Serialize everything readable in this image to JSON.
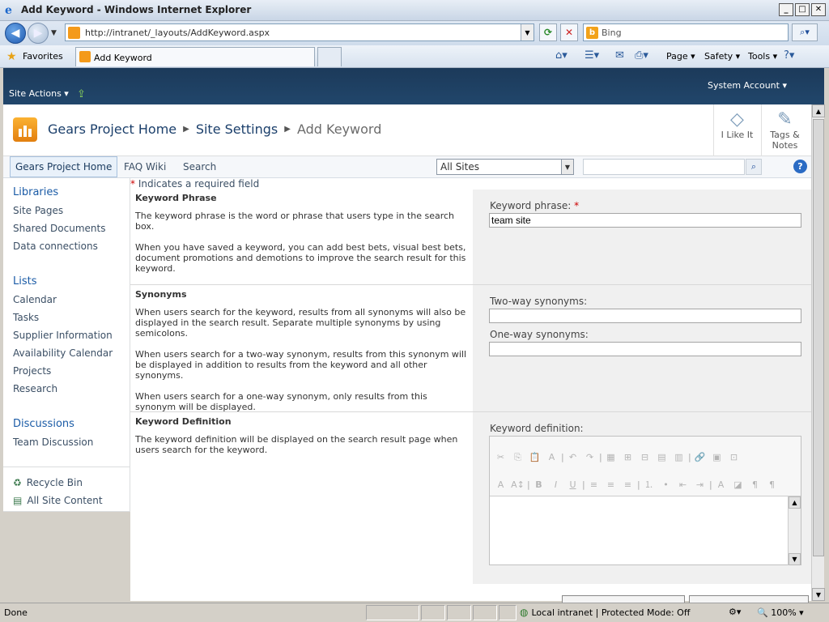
{
  "window": {
    "title": "Add Keyword - Windows Internet Explorer",
    "min_icon": "minimize-icon",
    "max_icon": "maximize-icon",
    "close_icon": "close-icon"
  },
  "browser": {
    "url": "http://intranet/_layouts/AddKeyword.aspx",
    "search_placeholder": "Bing",
    "favorites_label": "Favorites",
    "tab_title": "Add Keyword",
    "commands": [
      "Page",
      "Safety",
      "Tools"
    ]
  },
  "sharepoint": {
    "site_actions": "Site Actions",
    "user": "System Account",
    "breadcrumb": [
      "Gears Project Home",
      "Site Settings",
      "Add Keyword"
    ],
    "social": [
      {
        "label": "I Like It"
      },
      {
        "label": "Tags &",
        "label2": "Notes"
      }
    ],
    "topnav": [
      "Gears Project Home",
      "FAQ Wiki",
      "Search"
    ],
    "scope": "All Sites"
  },
  "leftnav": {
    "libraries_header": "Libraries",
    "libraries": [
      "Site Pages",
      "Shared Documents",
      "Data connections"
    ],
    "lists_header": "Lists",
    "lists": [
      "Calendar",
      "Tasks",
      "Supplier Information",
      "Availability Calendar",
      "Projects",
      "Research"
    ],
    "discussions_header": "Discussions",
    "discussions": [
      "Team Discussion"
    ],
    "recycle_bin": "Recycle Bin",
    "all_site_content": "All Site Content"
  },
  "form": {
    "required_note": "Indicates a required field",
    "required_mark": "*",
    "keyword_section": {
      "title": "Keyword Phrase",
      "p1": "The keyword phrase is the word or phrase that users type in the search box.",
      "p2": "When you have saved a keyword, you can add best bets, visual best bets, document promotions and demotions to improve the search result for this keyword.",
      "label": "Keyword phrase:",
      "value": "team site"
    },
    "synonyms_section": {
      "title": "Synonyms",
      "p1": "When users search for the keyword, results from all synonyms will also be displayed in the search result.  Separate multiple synonyms by using semicolons.",
      "p2": "When users search for a two-way synonym, results from this synonym will be displayed in addition to results from the keyword and all other synonyms.",
      "p3": "When users search for a one-way synonym, only results from this synonym will be displayed.",
      "two_way_label": "Two-way synonyms:",
      "two_way_value": "",
      "one_way_label": "One-way synonyms:",
      "one_way_value": ""
    },
    "definition_section": {
      "title": "Keyword Definition",
      "p1": "The keyword definition will be displayed on the search result page when users search for the keyword.",
      "label": "Keyword definition:"
    }
  },
  "status": {
    "left": "Done",
    "zone": "Local intranet | Protected Mode: Off",
    "zoom": "100%"
  }
}
